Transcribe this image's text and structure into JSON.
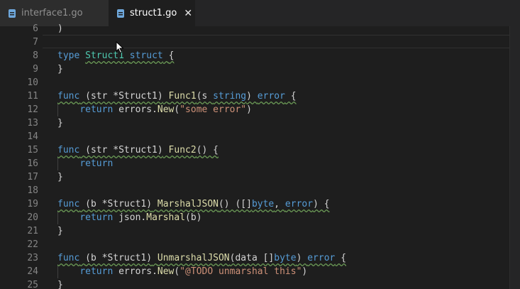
{
  "tabs": [
    {
      "label": "interface1.go",
      "active": false
    },
    {
      "label": "struct1.go",
      "active": true,
      "close": "✕"
    }
  ],
  "line_numbers": [
    "6",
    "7",
    "8",
    "9",
    "10",
    "11",
    "12",
    "13",
    "14",
    "15",
    "16",
    "17",
    "18",
    "19",
    "20",
    "21",
    "22",
    "23",
    "24",
    "25"
  ],
  "code": {
    "l6": ")",
    "l8": {
      "kw1": "type",
      "name": "Struct1",
      "kw2": "struct",
      "brace": "{"
    },
    "l9": "}",
    "l11": {
      "kw": "func",
      "recv": "(str *Struct1)",
      "fn": "Func1",
      "p1": "(s ",
      "ptype": "string",
      "p2": ") ",
      "ret": "error",
      "end": " {"
    },
    "l12": {
      "kw": "return",
      "pre": " errors.",
      "fn": "New",
      "o": "(",
      "str": "\"some error\"",
      "c": ")"
    },
    "l13": "}",
    "l15": {
      "kw": "func",
      "recv": "(str *Struct1)",
      "fn": "Func2",
      "rest": "() {"
    },
    "l16": {
      "kw": "return"
    },
    "l17": "}",
    "l19": {
      "kw": "func",
      "recv": "(b *Struct1)",
      "fn": "MarshalJSON",
      "p1": "() ([]",
      "t1": "byte",
      "comma": ", ",
      "t2": "error",
      "end": ") {"
    },
    "l20": {
      "kw": "return",
      "pre": " json.",
      "fn": "Marshal",
      "args": "(b)"
    },
    "l21": "}",
    "l23": {
      "kw": "func",
      "recv": "(b *Struct1)",
      "fn": "UnmarshalJSON",
      "p1": "(data []",
      "t1": "byte",
      "p2": ") ",
      "ret": "error",
      "end": " {"
    },
    "l24": {
      "kw": "return",
      "pre": " errors.",
      "fn": "New",
      "o": "(",
      "str": "\"@TODO unmarshal this\"",
      "c": ")"
    },
    "l25": "}"
  },
  "colors": {
    "keyword": "#569cd6",
    "type": "#4ec9b0",
    "function": "#dcdcaa",
    "string": "#ce9178",
    "squiggle": "#6a9955"
  }
}
